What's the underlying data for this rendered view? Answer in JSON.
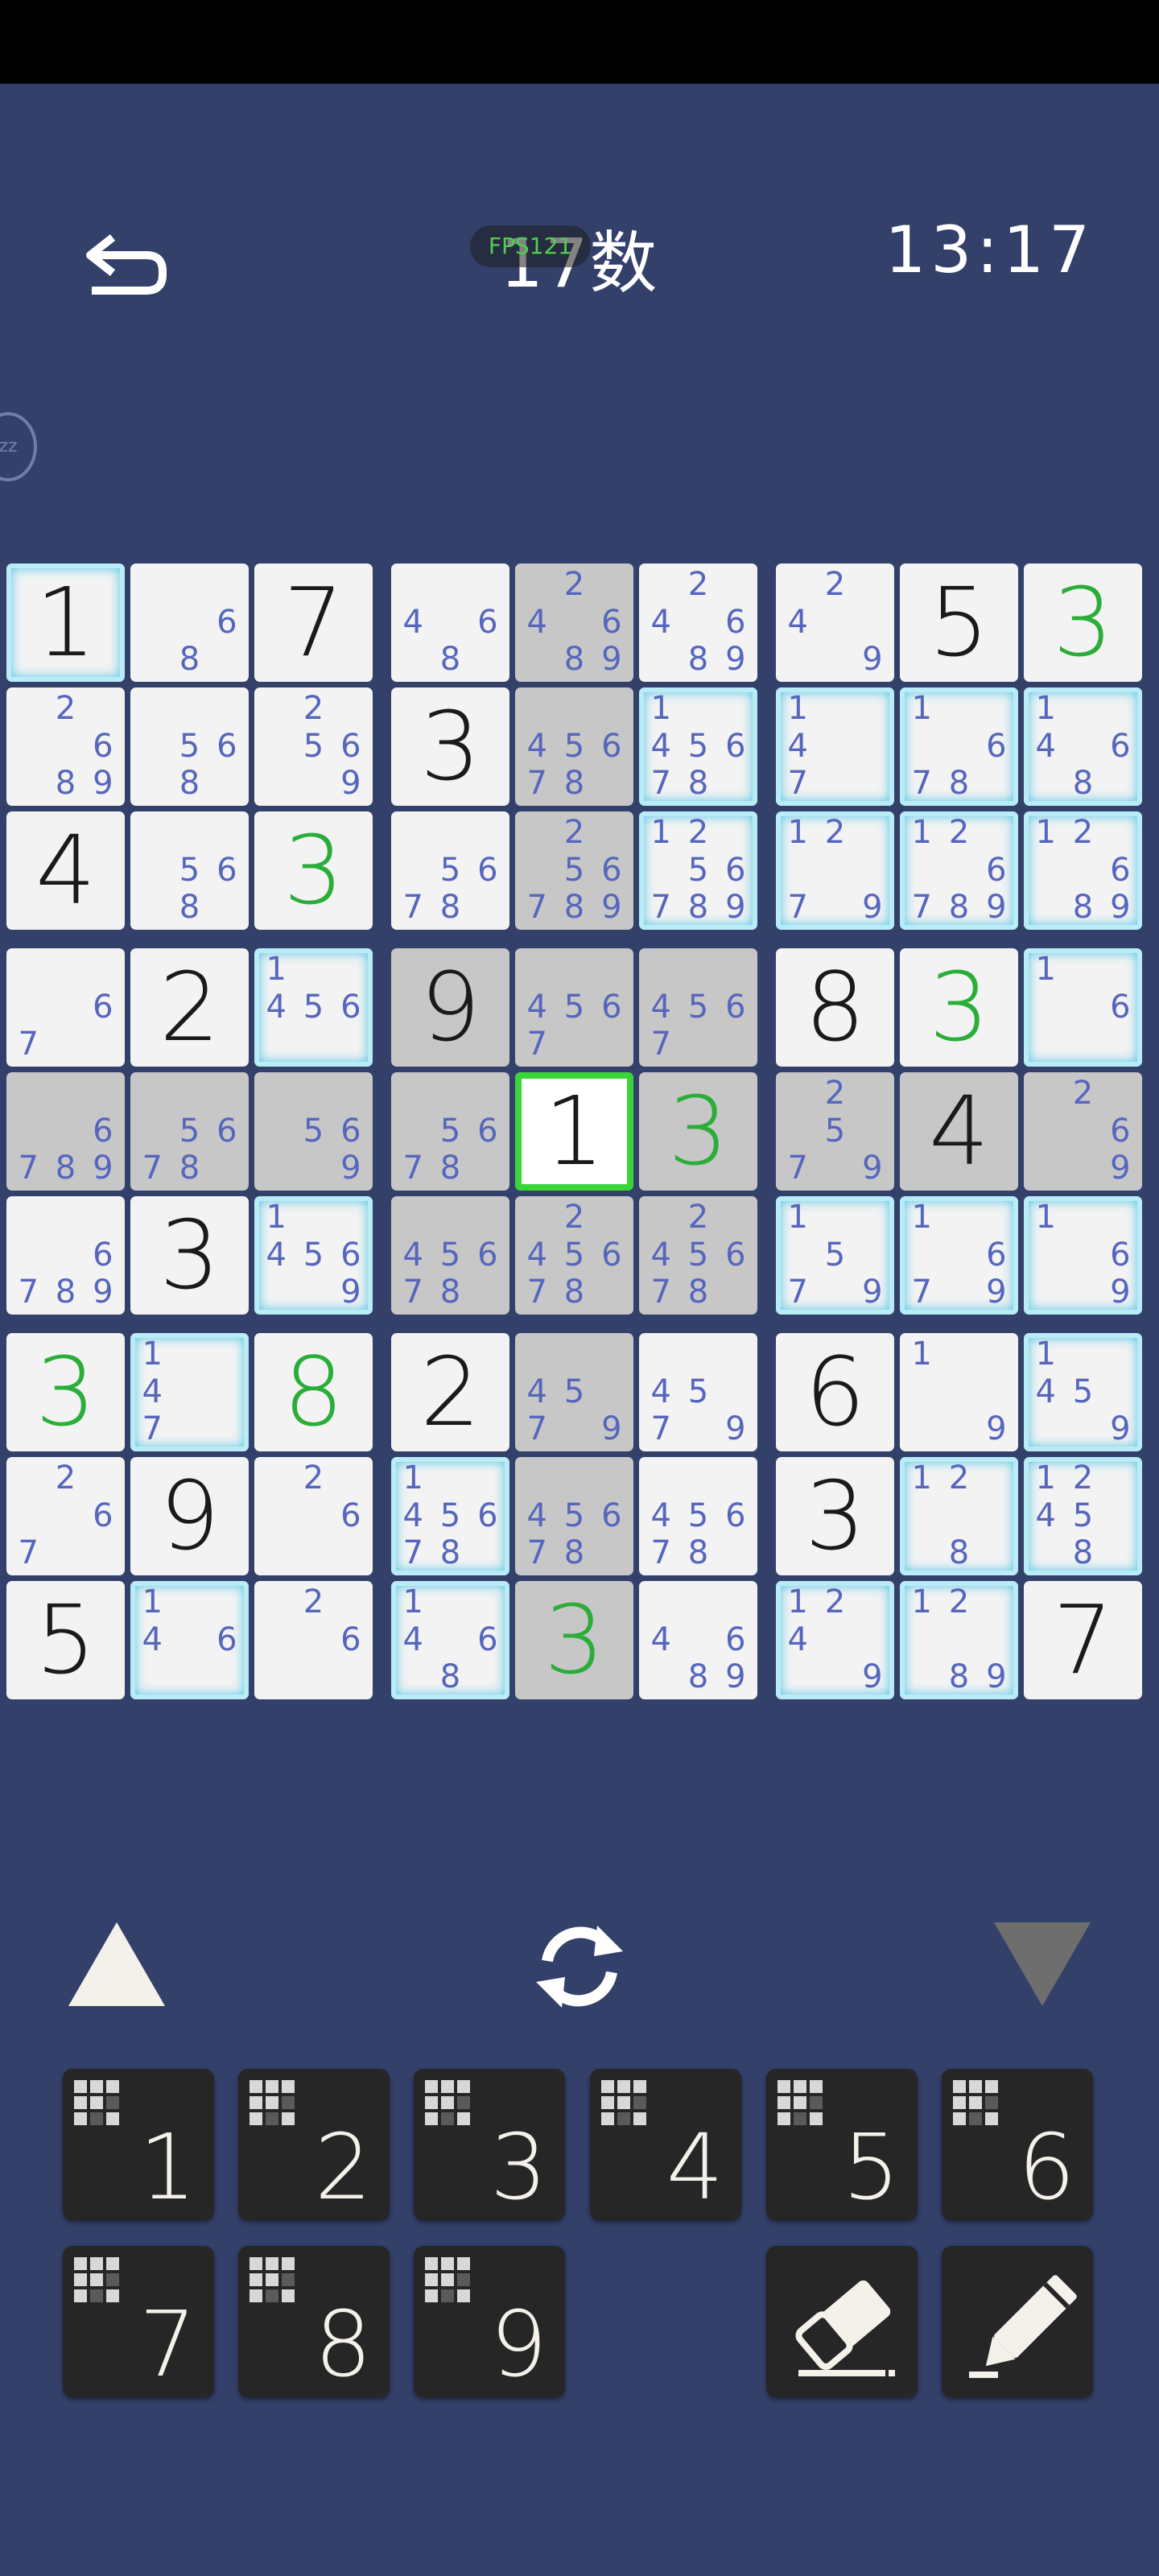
{
  "header": {
    "title": "17数",
    "fps": "FPS121",
    "timer": "13:17",
    "sleep_badge": "zz"
  },
  "board": {
    "grid": [
      [
        "1",
        "",
        "7",
        "",
        "",
        "",
        "",
        "5",
        "3"
      ],
      [
        "",
        "",
        "",
        "3",
        "",
        "",
        "",
        "",
        ""
      ],
      [
        "4",
        "",
        "3",
        "",
        "",
        "",
        "",
        "",
        ""
      ],
      [
        "",
        "2",
        "",
        "9",
        "",
        "",
        "8",
        "3",
        ""
      ],
      [
        "",
        "",
        "",
        "",
        "1",
        "3",
        "",
        "4",
        ""
      ],
      [
        "",
        "3",
        "",
        "",
        "",
        "",
        "",
        "",
        ""
      ],
      [
        "3",
        "",
        "8",
        "2",
        "",
        "",
        "6",
        "",
        ""
      ],
      [
        "",
        "9",
        "",
        "",
        "",
        "",
        "3",
        "",
        ""
      ],
      [
        "5",
        "",
        "",
        "",
        "3",
        "",
        "",
        "",
        "7"
      ]
    ],
    "user_entered": [
      [
        false,
        false,
        false,
        false,
        false,
        false,
        false,
        false,
        true
      ],
      [
        false,
        false,
        false,
        false,
        false,
        false,
        false,
        false,
        false
      ],
      [
        false,
        false,
        true,
        false,
        false,
        false,
        false,
        false,
        false
      ],
      [
        false,
        false,
        false,
        false,
        false,
        false,
        false,
        true,
        false
      ],
      [
        false,
        false,
        false,
        false,
        false,
        true,
        false,
        false,
        false
      ],
      [
        false,
        false,
        false,
        false,
        false,
        false,
        false,
        false,
        false
      ],
      [
        true,
        false,
        true,
        false,
        false,
        false,
        false,
        false,
        false
      ],
      [
        false,
        false,
        false,
        false,
        false,
        false,
        false,
        false,
        false
      ],
      [
        false,
        false,
        false,
        false,
        true,
        false,
        false,
        false,
        false
      ]
    ],
    "notes": [
      [
        [],
        [
          6,
          8
        ],
        [],
        [
          4,
          6,
          8
        ],
        [
          2,
          4,
          6,
          8,
          9
        ],
        [
          2,
          4,
          6,
          8,
          9
        ],
        [
          2,
          4,
          9
        ],
        [],
        []
      ],
      [
        [
          2,
          6,
          8,
          9
        ],
        [
          5,
          6,
          8
        ],
        [
          2,
          5,
          6,
          9
        ],
        [],
        [
          4,
          5,
          6,
          7,
          8
        ],
        [
          1,
          4,
          5,
          6,
          7,
          8
        ],
        [
          1,
          4,
          7
        ],
        [
          1,
          6,
          7,
          8
        ],
        [
          1,
          4,
          6,
          8
        ]
      ],
      [
        [],
        [
          5,
          6,
          8
        ],
        [],
        [
          5,
          6,
          7,
          8
        ],
        [
          2,
          5,
          6,
          7,
          8,
          9
        ],
        [
          1,
          2,
          5,
          6,
          7,
          8,
          9
        ],
        [
          1,
          2,
          7,
          9
        ],
        [
          1,
          2,
          6,
          7,
          8,
          9
        ],
        [
          1,
          2,
          6,
          8,
          9
        ]
      ],
      [
        [
          6,
          7
        ],
        [],
        [
          1,
          4,
          5,
          6
        ],
        [],
        [
          4,
          5,
          6,
          7
        ],
        [
          4,
          5,
          6,
          7
        ],
        [],
        [],
        [
          1,
          6
        ]
      ],
      [
        [
          6,
          7,
          8,
          9
        ],
        [
          5,
          6,
          7,
          8
        ],
        [
          5,
          6,
          9
        ],
        [
          5,
          6,
          7,
          8
        ],
        [],
        [],
        [
          2,
          5,
          7,
          9
        ],
        [],
        [
          2,
          6,
          9
        ]
      ],
      [
        [
          6,
          7,
          8,
          9
        ],
        [],
        [
          1,
          4,
          5,
          6,
          9
        ],
        [
          4,
          5,
          6,
          7,
          8
        ],
        [
          2,
          4,
          5,
          6,
          7,
          8
        ],
        [
          2,
          4,
          5,
          6,
          7,
          8
        ],
        [
          1,
          5,
          7,
          9
        ],
        [
          1,
          6,
          7,
          9
        ],
        [
          1,
          6,
          9
        ]
      ],
      [
        [],
        [
          1,
          4,
          7
        ],
        [],
        [],
        [
          4,
          5,
          7,
          9
        ],
        [
          4,
          5,
          7,
          9
        ],
        [],
        [
          1,
          9
        ],
        [
          1,
          4,
          5,
          9
        ]
      ],
      [
        [
          2,
          6,
          7
        ],
        [],
        [
          2,
          6
        ],
        [
          1,
          4,
          5,
          6,
          7,
          8
        ],
        [
          4,
          5,
          6,
          7,
          8
        ],
        [
          4,
          5,
          6,
          7,
          8
        ],
        [],
        [
          1,
          2,
          8
        ],
        [
          1,
          2,
          4,
          5,
          8
        ]
      ],
      [
        [],
        [
          1,
          4,
          6
        ],
        [
          2,
          6
        ],
        [
          1,
          4,
          6,
          8
        ],
        [],
        [
          4,
          6,
          8,
          9
        ],
        [
          1,
          2,
          4,
          9
        ],
        [
          1,
          2,
          8,
          9
        ],
        []
      ]
    ],
    "gray_cells": [
      [
        0,
        4
      ],
      [
        1,
        4
      ],
      [
        2,
        4
      ],
      [
        3,
        3
      ],
      [
        3,
        4
      ],
      [
        3,
        5
      ],
      [
        4,
        0
      ],
      [
        4,
        1
      ],
      [
        4,
        2
      ],
      [
        4,
        3
      ],
      [
        4,
        5
      ],
      [
        4,
        6
      ],
      [
        4,
        7
      ],
      [
        4,
        8
      ],
      [
        5,
        3
      ],
      [
        5,
        4
      ],
      [
        5,
        5
      ],
      [
        6,
        4
      ],
      [
        7,
        4
      ],
      [
        8,
        4
      ]
    ],
    "highlight_cells": [
      [
        0,
        0
      ],
      [
        1,
        5
      ],
      [
        1,
        6
      ],
      [
        1,
        7
      ],
      [
        1,
        8
      ],
      [
        2,
        5
      ],
      [
        2,
        6
      ],
      [
        2,
        7
      ],
      [
        2,
        8
      ],
      [
        3,
        2
      ],
      [
        3,
        8
      ],
      [
        5,
        2
      ],
      [
        5,
        6
      ],
      [
        5,
        7
      ],
      [
        5,
        8
      ],
      [
        6,
        1
      ],
      [
        6,
        8
      ],
      [
        7,
        3
      ],
      [
        7,
        7
      ],
      [
        7,
        8
      ],
      [
        8,
        1
      ],
      [
        8,
        3
      ],
      [
        8,
        6
      ],
      [
        8,
        7
      ]
    ],
    "selected_cell": [
      4,
      4
    ]
  },
  "keypad": {
    "digits": [
      "1",
      "2",
      "3",
      "4",
      "5",
      "6",
      "7",
      "8",
      "9"
    ],
    "eraser_icon": "eraser-icon",
    "pencil_icon": "pencil-icon"
  },
  "controls": {
    "up_icon": "triangle-up-icon",
    "refresh_icon": "refresh-icon",
    "down_icon": "triangle-down-icon"
  },
  "colors": {
    "background": "#33406a",
    "note": "#5666bd",
    "user_digit": "#2aae39",
    "selected_border": "#38d638",
    "highlight_glow": "#54c6e6"
  }
}
